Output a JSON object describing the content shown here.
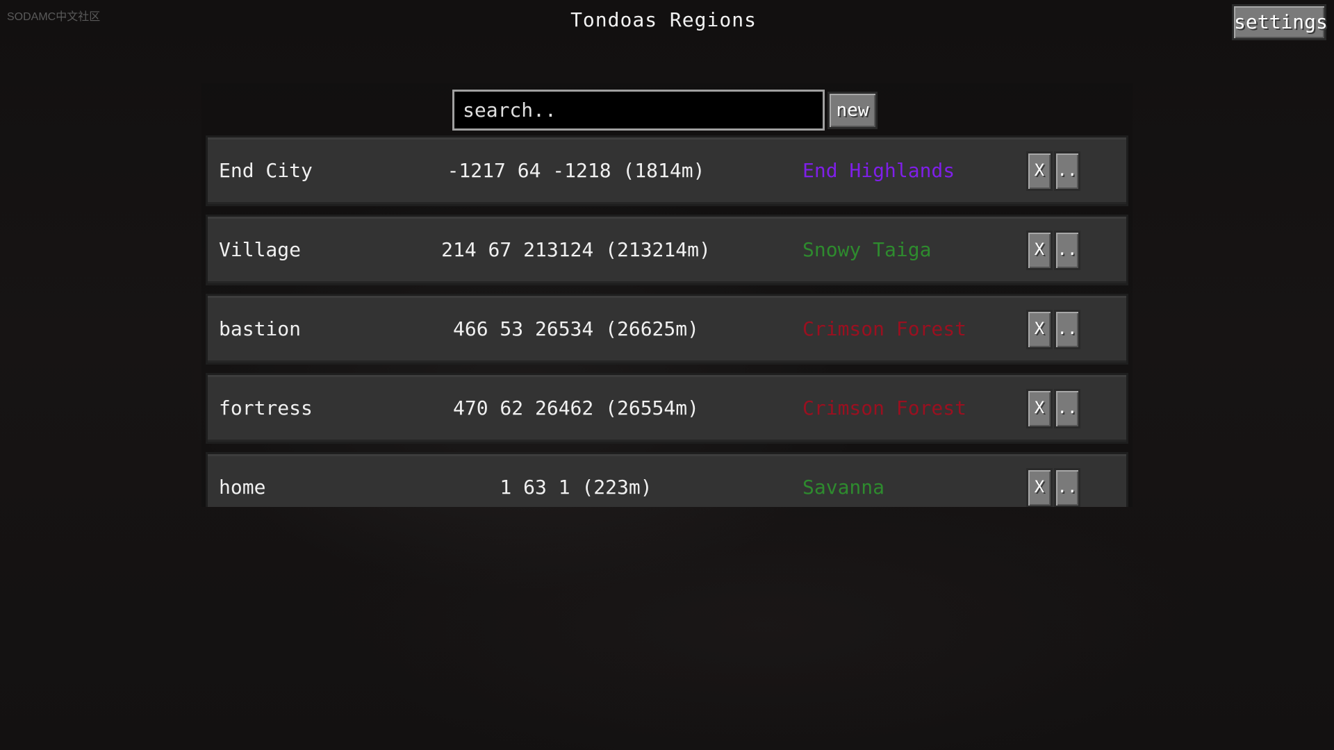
{
  "watermark": "SODAMC中文社区",
  "header": {
    "title": "Tondoas Regions",
    "settings_label": "settings"
  },
  "search": {
    "placeholder": "search..",
    "value": "",
    "new_label": "new"
  },
  "regions": [
    {
      "name": "End City",
      "coords": "-1217 64 -1218 (1814m)",
      "biome": "End Highlands",
      "biome_color": "#7f1fe8",
      "delete_label": "X",
      "more_label": ".."
    },
    {
      "name": "Village",
      "coords": "214 67 213124 (213214m)",
      "biome": "Snowy Taiga",
      "biome_color": "#2e8b2e",
      "delete_label": "X",
      "more_label": ".."
    },
    {
      "name": "bastion",
      "coords": "466 53 26534 (26625m)",
      "biome": "Crimson Forest",
      "biome_color": "#9a1020",
      "delete_label": "X",
      "more_label": ".."
    },
    {
      "name": "fortress",
      "coords": "470 62 26462 (26554m)",
      "biome": "Crimson Forest",
      "biome_color": "#9a1020",
      "delete_label": "X",
      "more_label": ".."
    },
    {
      "name": "home",
      "coords": "1 63 1 (223m)",
      "biome": "Savanna",
      "biome_color": "#2e8b2e",
      "delete_label": "X",
      "more_label": ".."
    }
  ]
}
